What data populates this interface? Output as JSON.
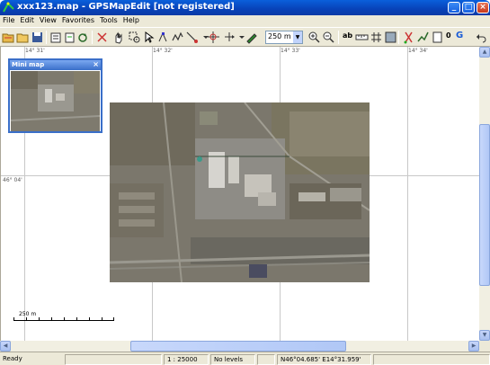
{
  "window": {
    "title": "xxx123.map - GPSMapEdit [not registered]",
    "minimize": "_",
    "maximize": "□",
    "close": "×"
  },
  "menu": [
    "File",
    "Edit",
    "View",
    "Favorites",
    "Tools",
    "Help"
  ],
  "toolbar": {
    "zoom_value": "250 m",
    "ab_label": "ab",
    "n_label": "0",
    "g_label": "G"
  },
  "map": {
    "grid_labels_top": [
      "14° 31'",
      "14° 32'",
      "14° 33'",
      "14° 34'"
    ],
    "grid_label_left": "46° 04'"
  },
  "minimap": {
    "title": "Mini map",
    "close": "×"
  },
  "scalebar": {
    "label": "250 m"
  },
  "status": {
    "ready": "Ready",
    "scale": "1 : 25000",
    "levels": "No levels",
    "coords": "N46°04.685' E14°31.959'"
  },
  "colors": {
    "titlebar": "#0842b8",
    "chrome": "#ece9d8",
    "accent": "#3a6fc9"
  }
}
